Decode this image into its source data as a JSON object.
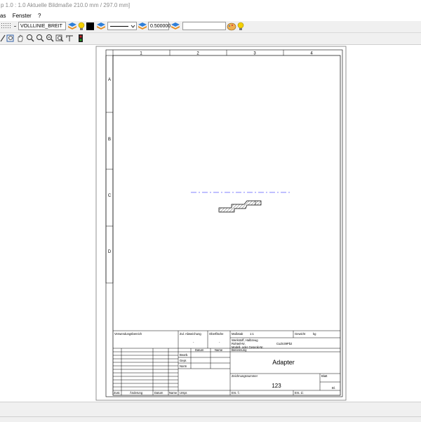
{
  "window": {
    "title": "p 1.0 : 1.0   Aktuelle Bildmaße 210.0 mm / 297.0 mm]"
  },
  "menu": {
    "items": [
      "as",
      "Fenster",
      "?"
    ]
  },
  "toolbar": {
    "line_style": "VOLLLINIE_BREIT",
    "line_width": "0.500000",
    "empty_field": ""
  },
  "drawing": {
    "columns": [
      "1",
      "2",
      "3",
      "4"
    ],
    "rows": [
      "A",
      "B",
      "C",
      "D"
    ]
  },
  "title_block": {
    "verwendungsbereich": "Verwendungsbereich",
    "zul_abweichung": "Zul. Abweichung",
    "oberflaeche": "Oberfläche",
    "massstab": "Maßstab",
    "massstab_value": "1:1",
    "gewicht": "Gewicht",
    "gewicht_value": "kg",
    "dash1": "-",
    "dash2": "-",
    "werkstoff": "Werkstoff, Halbzeug",
    "rohteil": "Rohteil-Nr.",
    "rohteil_value": "CuZn39Pb2",
    "modell": "Modell- oder Gesenk-Nr.",
    "datum": "Datum",
    "name": "Name",
    "benennung": "Benennung",
    "bearb": "Bearb.",
    "gepr": "Gepr.",
    "norm": "Norm",
    "part_name": "Adapter",
    "zeichnungsnummer": "Zeichnungsnummer",
    "blatt": "Blatt",
    "drawing_number": "123",
    "bl": "Bl.",
    "zust": "Zust.",
    "aenderung": "Änderung",
    "datum2": "Datum",
    "name2": "Name",
    "urspr": "Urspr.",
    "ers_f": "Ers. f.:",
    "ers_d": "Ers. d.:"
  },
  "colors": {
    "accent_blue": "#1f6fd1",
    "centerline_blue": "#5a5aff",
    "bulb_yellow": "#f4d000"
  }
}
